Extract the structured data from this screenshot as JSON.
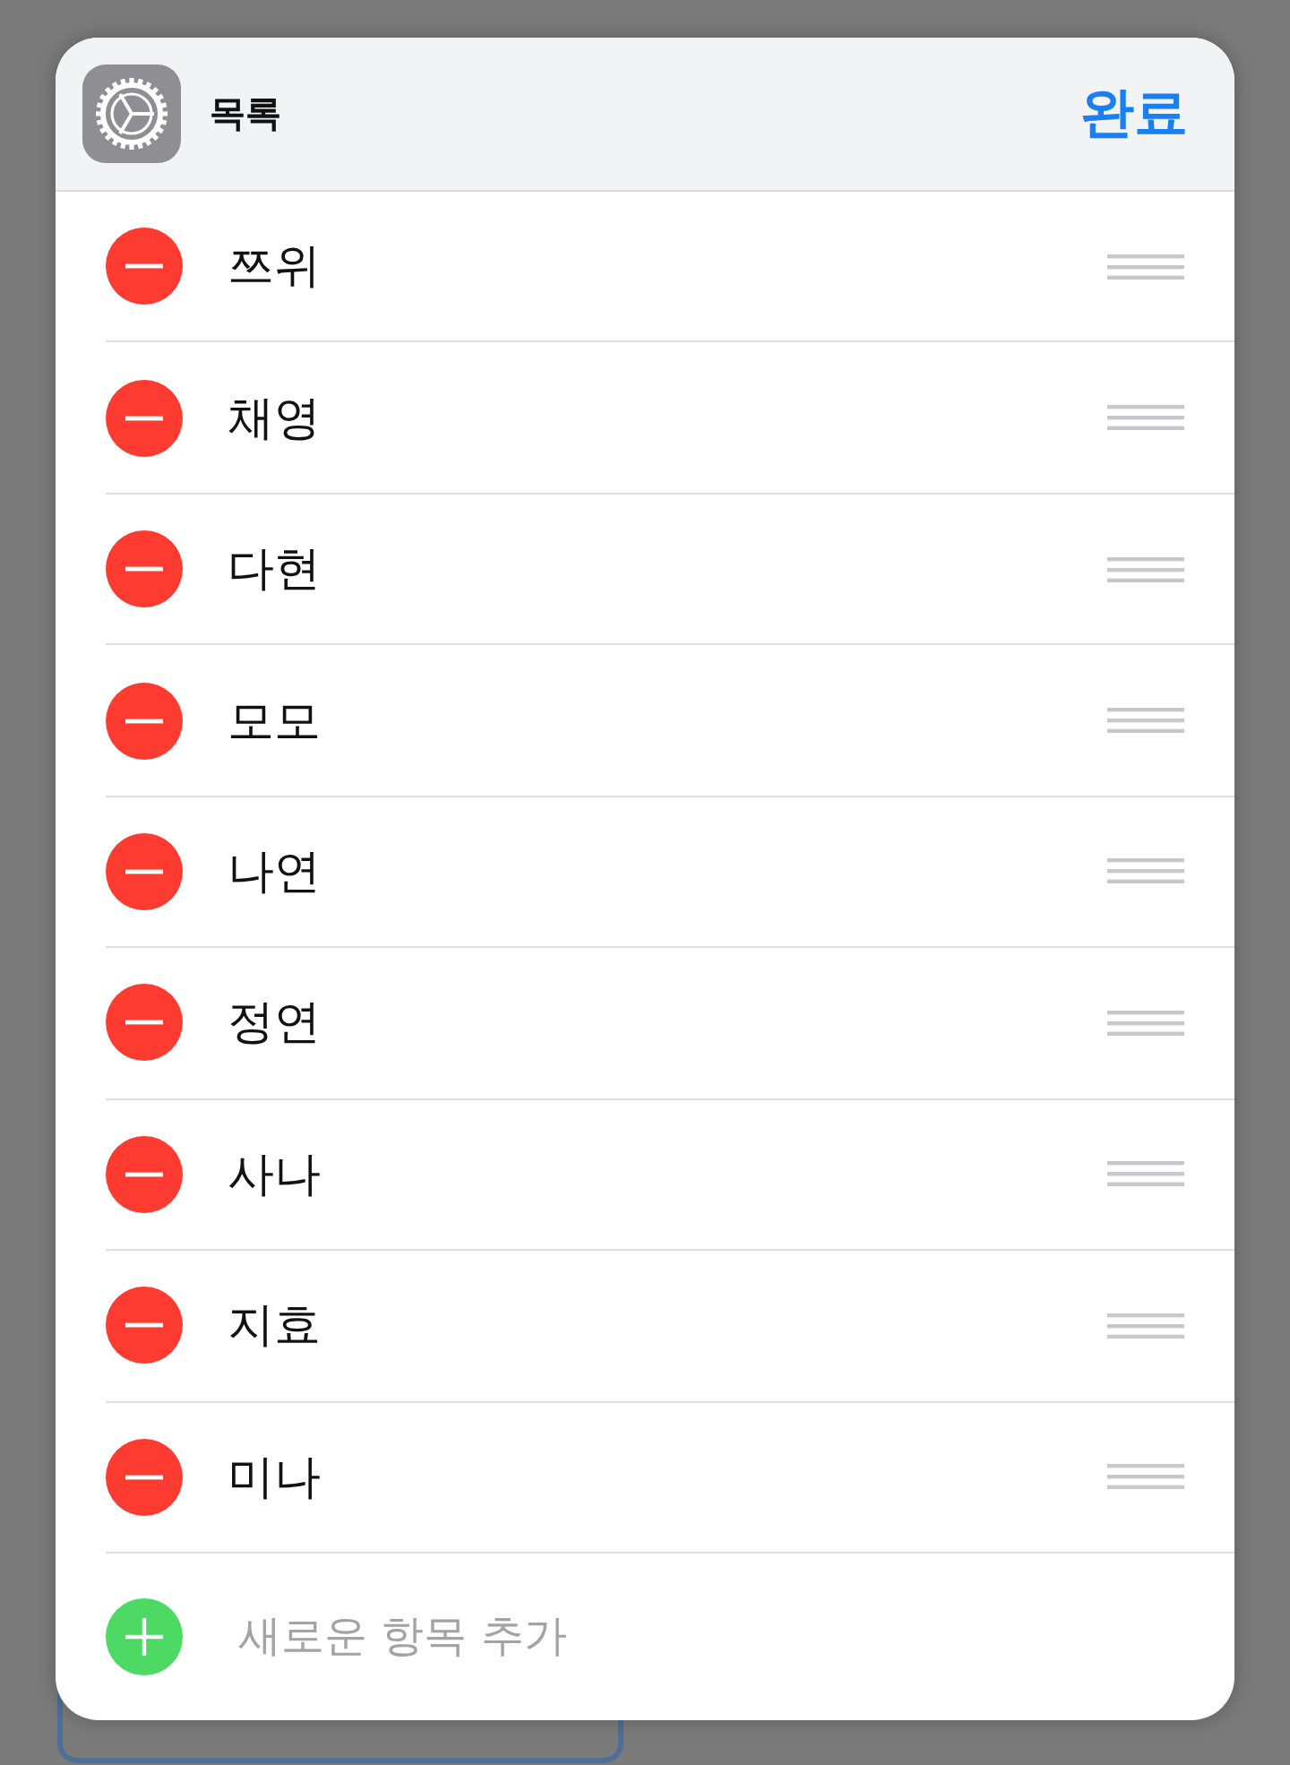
{
  "header": {
    "title": "목록",
    "done_button": "완료"
  },
  "items": [
    {
      "name": "쯔위"
    },
    {
      "name": "채영"
    },
    {
      "name": "다현"
    },
    {
      "name": "모모"
    },
    {
      "name": "나연"
    },
    {
      "name": "정연"
    },
    {
      "name": "사나"
    },
    {
      "name": "지효"
    },
    {
      "name": "미나"
    }
  ],
  "add_row": {
    "label": "새로운 항목 추가"
  }
}
